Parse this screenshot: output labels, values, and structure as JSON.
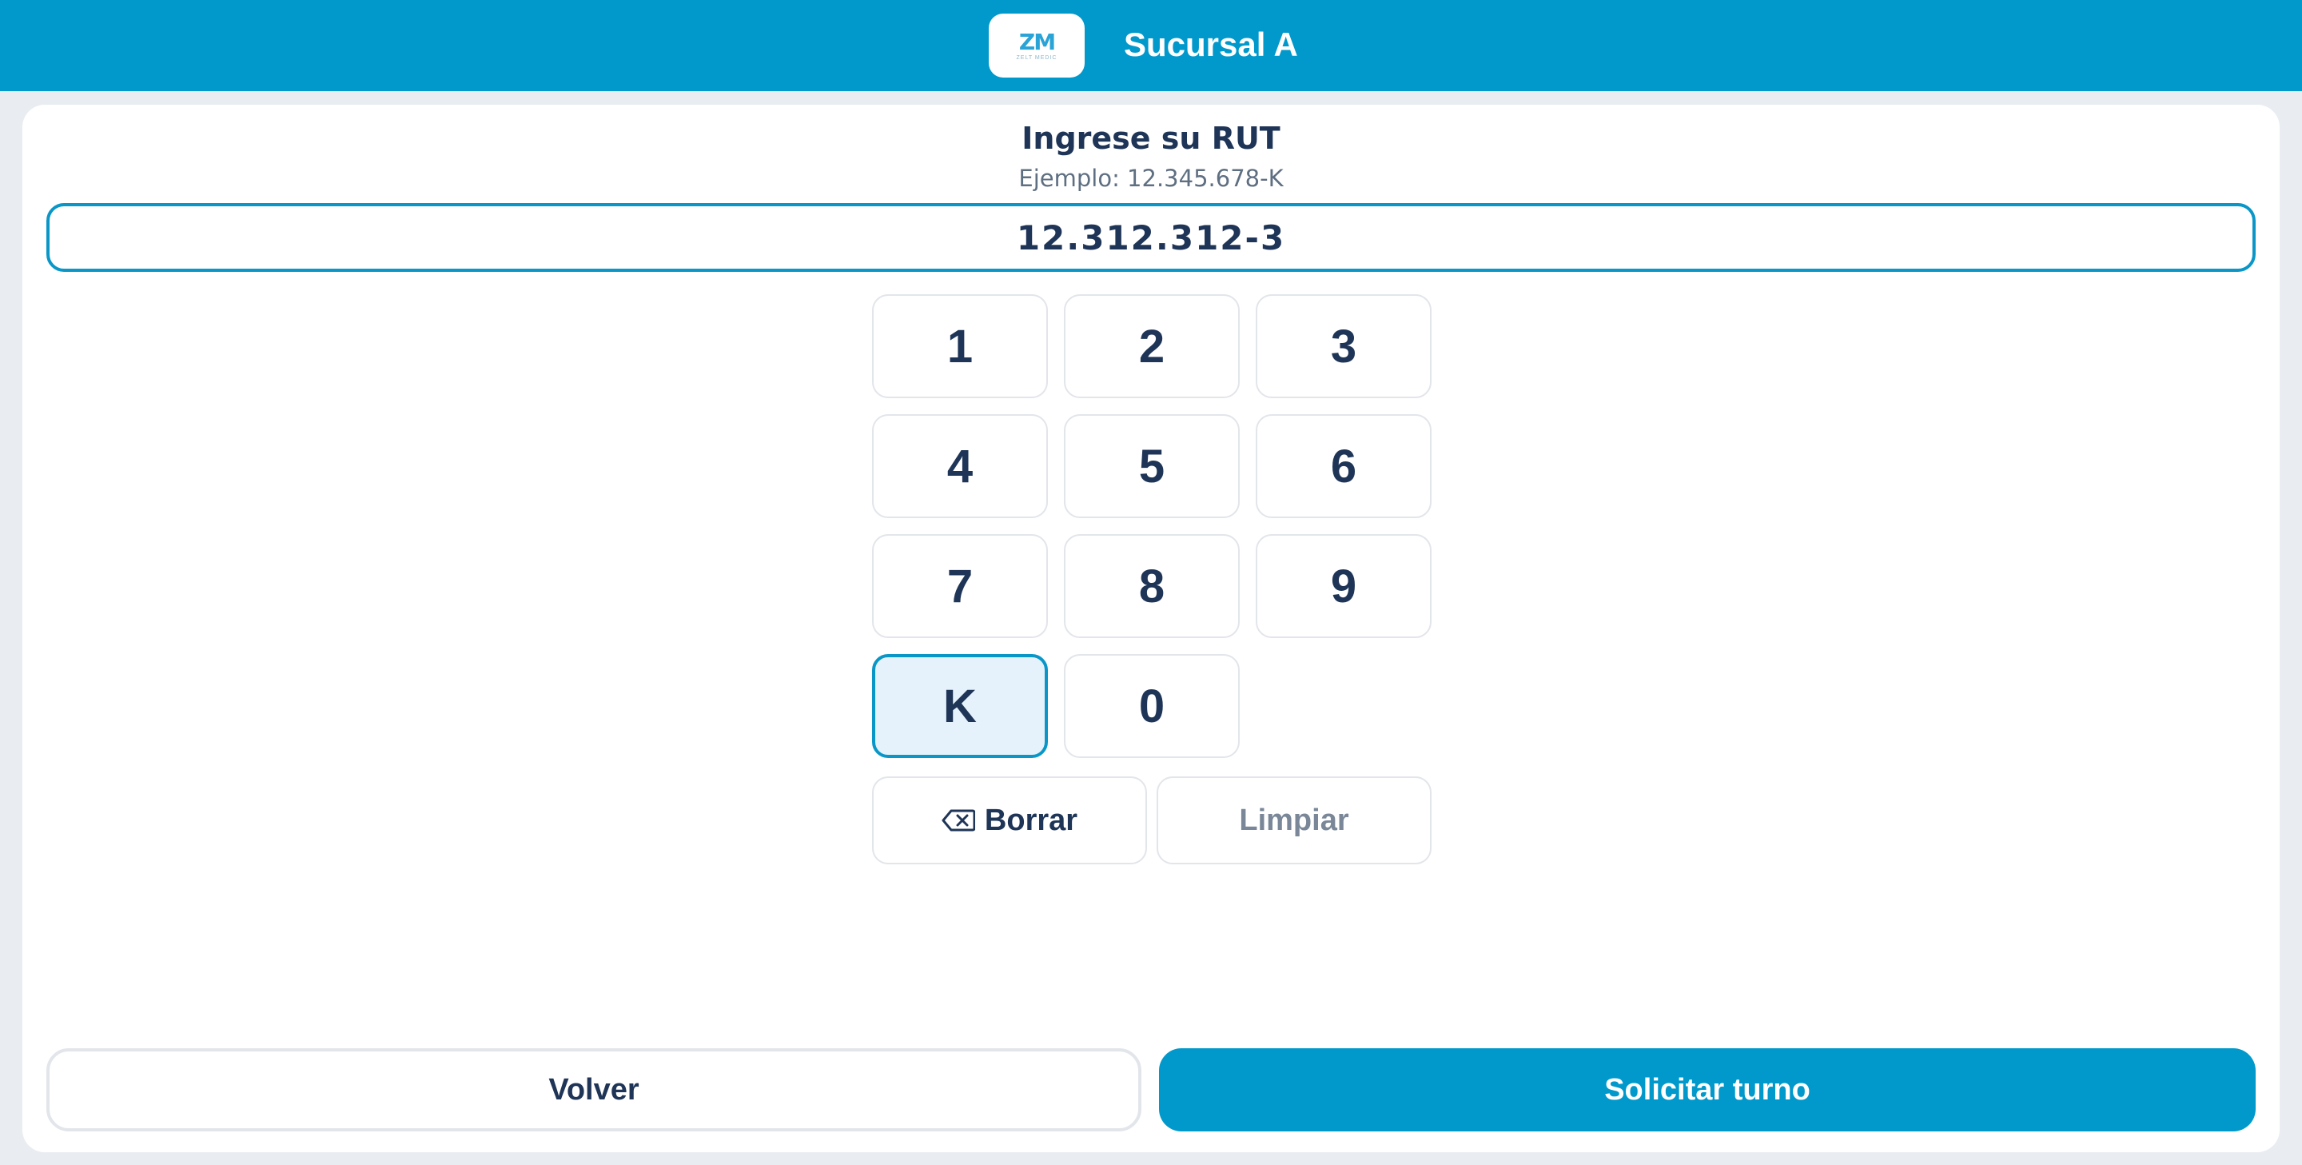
{
  "header": {
    "logo_text": "ZM",
    "logo_subtext": "ZELT MEDIC",
    "branch_title": "Sucursal A"
  },
  "prompt": {
    "title": "Ingrese su RUT",
    "example": "Ejemplo: 12.345.678-K"
  },
  "rut_input": {
    "value": "12.312.312-3"
  },
  "keypad": {
    "k1": "1",
    "k2": "2",
    "k3": "3",
    "k4": "4",
    "k5": "5",
    "k6": "6",
    "k7": "7",
    "k8": "8",
    "k9": "9",
    "kK": "K",
    "k0": "0",
    "active_key": "K"
  },
  "actions": {
    "delete_label": "Borrar",
    "delete_icon": "backspace-icon",
    "clear_label": "Limpiar"
  },
  "footer": {
    "back_label": "Volver",
    "submit_label": "Solicitar turno"
  },
  "colors": {
    "brand": "#0199cb",
    "text": "#1f3557",
    "active_key_bg": "#e5f2fb"
  }
}
